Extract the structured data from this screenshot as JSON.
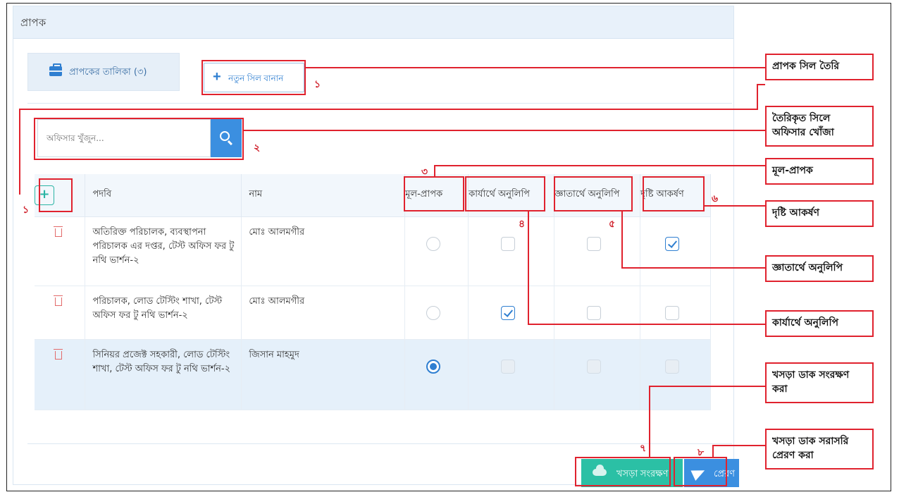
{
  "panel": {
    "title": "প্রাপক"
  },
  "list_tab": {
    "label": "প্রাপকের তালিকা (৩)"
  },
  "new_seal_button": {
    "label": "নতুন সিল বানান"
  },
  "search": {
    "placeholder": "অফিসার খুঁজুন..."
  },
  "table": {
    "headers": [
      "পদবি",
      "নাম",
      "মূল-প্রাপক",
      "কার্যার্থে অনুলিপি",
      "জ্ঞাতার্থে অনুলিপি",
      "দৃষ্টি আকর্ষণ"
    ],
    "rows": [
      {
        "designation": "অতিরিক্ত পরিচালক, ব্যবস্থাপনা পরিচালক এর দপ্তর, টেস্ট অফিস ফর টু নথি ভার্শন-২",
        "name": "মোঃ আলমগীর",
        "main": false,
        "action_copy": false,
        "info_copy": false,
        "attention": true,
        "selected": false
      },
      {
        "designation": "পরিচালক, লোড টেস্টিং শাখা, টেস্ট অফিস ফর টু নথি ভার্শন-২",
        "name": "মোঃ আলমগীর",
        "main": false,
        "action_copy": true,
        "info_copy": false,
        "attention": false,
        "selected": false
      },
      {
        "designation": "সিনিয়র প্রজেক্ট সহকারী, লোড টেস্টিং শাখা, টেস্ট অফিস ফর টু নথি ভার্শন-২",
        "name": "জিসান মাহমুদ",
        "main": true,
        "action_copy": false,
        "info_copy": false,
        "attention": false,
        "selected": true
      }
    ]
  },
  "buttons": {
    "save_draft": "খসড়া সংরক্ষণ",
    "send": "প্রেরণ"
  },
  "markers": {
    "m1": "১",
    "m1b": "১",
    "m2": "২",
    "m3": "৩",
    "m4": "৪",
    "m5": "৫",
    "m6": "৬",
    "m7": "৭",
    "m8": "৮"
  },
  "callouts": {
    "c1": "প্রাপক সিল তৈরি",
    "c2": "তৈরিকৃত সিলে অফিসার খোঁজা",
    "c3": "মূল-প্রাপক",
    "c4": "দৃষ্টি আকর্ষণ",
    "c5": "জ্ঞাতার্থে অনুলিপি",
    "c6": "কার্যার্থে অনুলিপি",
    "c7": "খসড়া ডাক সংরক্ষণ করা",
    "c8": "খসড়া ডাক সরাসরি প্রেরণ করা"
  },
  "colors": {
    "accent": "#3b8fe0",
    "teal": "#2bc0a5",
    "annotation": "#e0222e"
  }
}
